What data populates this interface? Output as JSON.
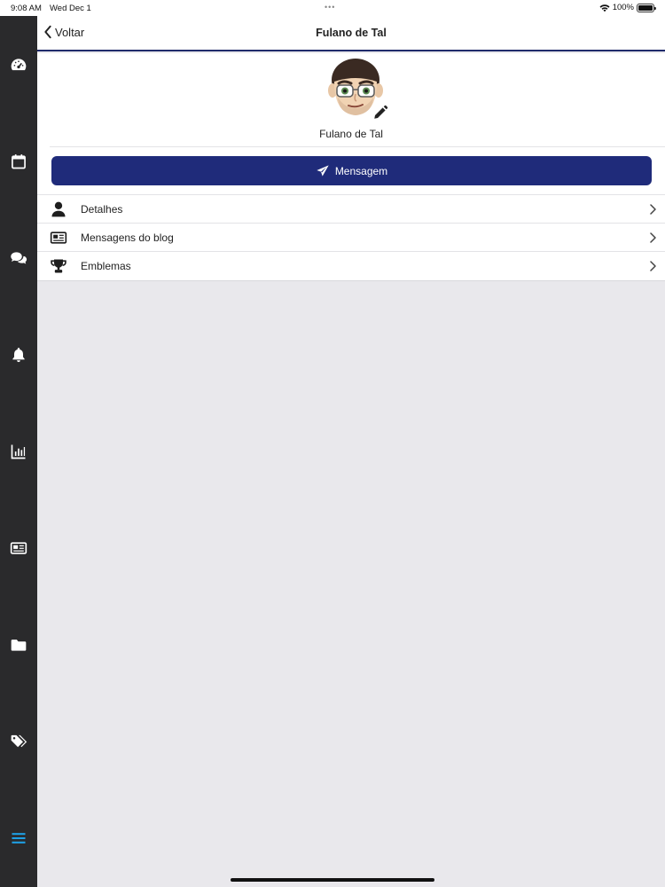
{
  "status_bar": {
    "time": "9:08 AM",
    "date": "Wed Dec 1",
    "battery": "100%",
    "battery_level": 1.0
  },
  "navbar": {
    "back_label": "Voltar",
    "title": "Fulano de Tal"
  },
  "profile": {
    "name": "Fulano de Tal"
  },
  "actions": {
    "message_label": "Mensagem"
  },
  "menu": [
    {
      "label": "Detalhes",
      "icon": "user-icon"
    },
    {
      "label": "Mensagens do blog",
      "icon": "newspaper-icon"
    },
    {
      "label": "Emblemas",
      "icon": "trophy-icon"
    }
  ],
  "sidebar": {
    "items": [
      {
        "icon": "dashboard-icon"
      },
      {
        "icon": "calendar-icon"
      },
      {
        "icon": "comments-icon"
      },
      {
        "icon": "bell-icon"
      },
      {
        "icon": "chart-icon"
      },
      {
        "icon": "newspaper-icon"
      },
      {
        "icon": "folder-icon"
      },
      {
        "icon": "tags-icon"
      },
      {
        "icon": "menu-icon",
        "active": true
      }
    ]
  },
  "colors": {
    "primary": "#1f2b7a",
    "sidebar_bg": "#2a2a2c",
    "active_icon": "#1ea0e6",
    "page_bg": "#e9e8ec"
  }
}
